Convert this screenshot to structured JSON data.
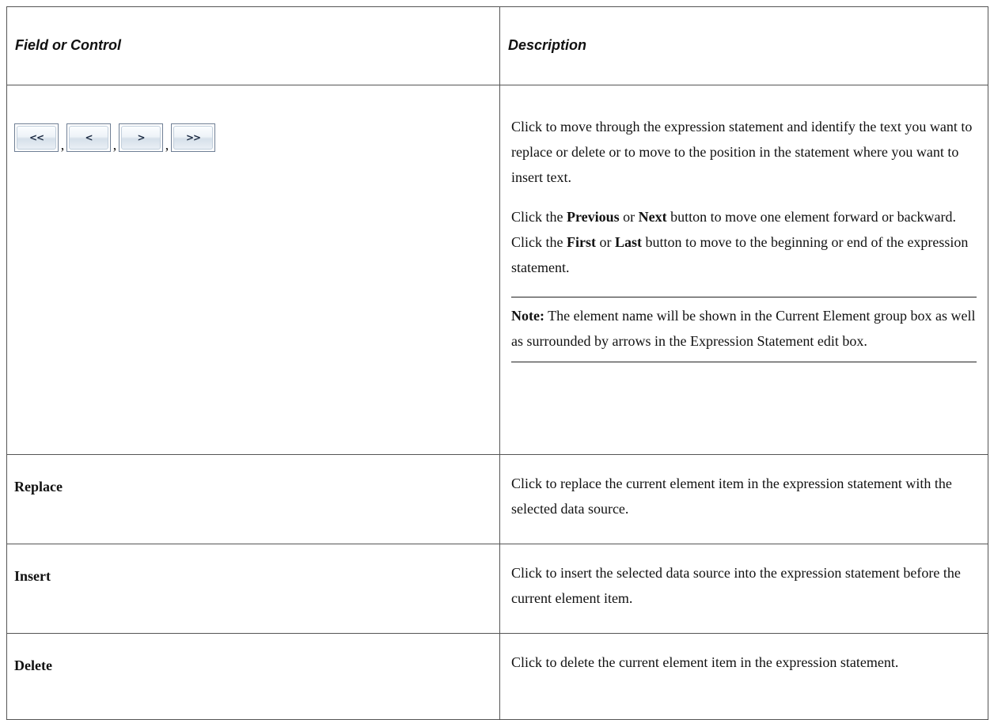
{
  "table": {
    "header": {
      "col1": "Field or Control",
      "col2": "Description"
    },
    "nav_row": {
      "buttons": [
        {
          "name": "first",
          "glyph": "<<"
        },
        {
          "name": "previous",
          "glyph": "<"
        },
        {
          "name": "next",
          "glyph": ">"
        },
        {
          "name": "last",
          "glyph": ">>"
        }
      ],
      "separator": ",",
      "p1": "Click to move through the expression statement and identify the text you want to replace or delete or to move to the position in the statement where you want to insert text.",
      "p2": {
        "t1": "Click the ",
        "b1": "Previous",
        "t2": " or ",
        "b2": "Next",
        "t3": " button to move one element forward or backward. Click the ",
        "b3": "First",
        "t4": " or ",
        "b4": "Last",
        "t5": " button to move to the beginning or end of the expression statement."
      },
      "note": {
        "label": "Note:",
        "text": " The element name will be shown in the Current Element group box as well as surrounded by arrows in the Expression Statement edit box."
      }
    },
    "rows": [
      {
        "field": "Replace",
        "description": "Click to replace the current element item in the expression statement with the selected data source."
      },
      {
        "field": "Insert",
        "description": "Click to insert the selected data source into the expression statement before the current element item."
      },
      {
        "field": "Delete",
        "description": "Click to delete the current element item in the expression statement."
      }
    ]
  }
}
